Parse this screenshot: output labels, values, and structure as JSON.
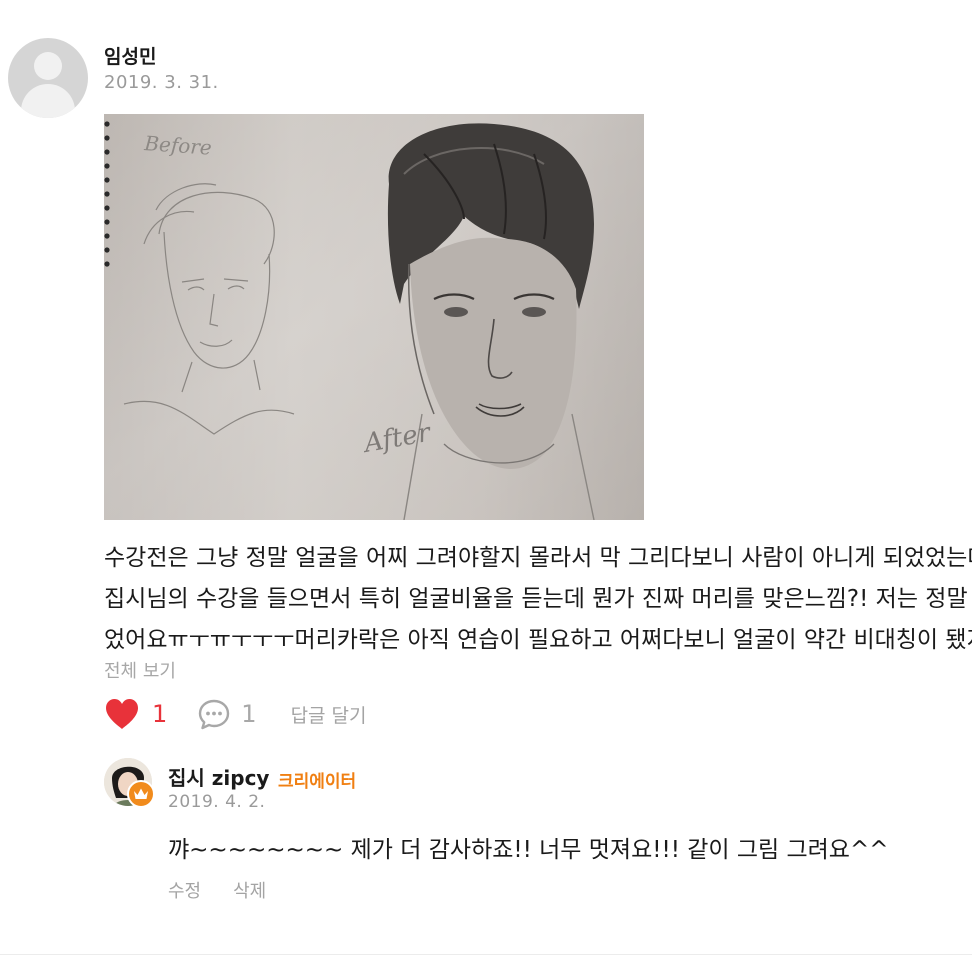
{
  "post": {
    "author": "임성민",
    "date": "2019. 3. 31.",
    "photo_labels": {
      "before": "Before",
      "after": "After"
    },
    "text_lines": [
      "수강전은 그냥 정말 얼굴을 어찌 그려야할지 몰라서 막 그리다보니 사람이 아니게 되었었는데",
      "집시님의 수강을 들으면서 특히 얼굴비율을 듣는데 뭔가 진짜 머리를 맞은느낌?! 저는 정말",
      "었어요ㅠㅜㅠㅜㅜㅜ머리카락은 아직 연습이 필요하고 어쩌다보니 얼굴이 약간 비대칭이 됐지만"
    ],
    "see_all": "전체 보기",
    "like_count": "1",
    "comment_count": "1",
    "reply_button": "답글 달기"
  },
  "reply": {
    "author": "집시 zipcy",
    "badge": "크리에이터",
    "date": "2019. 4. 2.",
    "text": "꺄~~~~~~~~ 제가 더 감사하죠!! 너무 멋져요!!! 같이 그림 그려요^^",
    "edit": "수정",
    "delete": "삭제"
  },
  "icons": {
    "like": "heart-icon",
    "comment": "speech-bubble-icon",
    "badge": "crown-icon"
  },
  "colors": {
    "heart": "#e8323a",
    "creator": "#f07f12"
  }
}
